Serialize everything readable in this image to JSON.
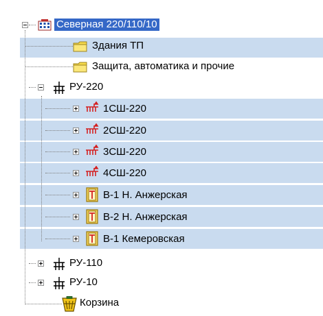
{
  "tree": {
    "root": {
      "label": "Северная 220/110/10",
      "icon": "substation-icon",
      "expanded": true
    },
    "nodes": [
      {
        "label": "Здания ТП",
        "icon": "folder-icon"
      },
      {
        "label": "Защита, автоматика и прочие",
        "icon": "folder-icon"
      },
      {
        "label": "РУ-220",
        "icon": "switchgear-icon",
        "expanded": true
      },
      {
        "label": "1СШ-220",
        "icon": "busbar-icon",
        "expanded": false
      },
      {
        "label": "2СШ-220",
        "icon": "busbar-icon",
        "expanded": false
      },
      {
        "label": "3СШ-220",
        "icon": "busbar-icon",
        "expanded": false
      },
      {
        "label": "4СШ-220",
        "icon": "busbar-icon",
        "expanded": false
      },
      {
        "label": "В-1 Н. Анжерская",
        "icon": "breaker-bay-icon",
        "expanded": false
      },
      {
        "label": "В-2 Н. Анжерская",
        "icon": "breaker-bay-icon",
        "expanded": false
      },
      {
        "label": "В-1 Кемеровская",
        "icon": "breaker-bay-icon",
        "expanded": false
      },
      {
        "label": "РУ-110",
        "icon": "switchgear-icon",
        "expanded": false
      },
      {
        "label": "РУ-10",
        "icon": "switchgear-icon",
        "expanded": false
      },
      {
        "label": "Корзина",
        "icon": "trash-bin-icon"
      }
    ]
  },
  "colors": {
    "selection_bg": "#c9dbef",
    "focused_bg": "#3568c7",
    "folder_yellow": "#f5d94a",
    "busbar_red": "#d42020",
    "connector_gray": "#7d7d7d"
  }
}
